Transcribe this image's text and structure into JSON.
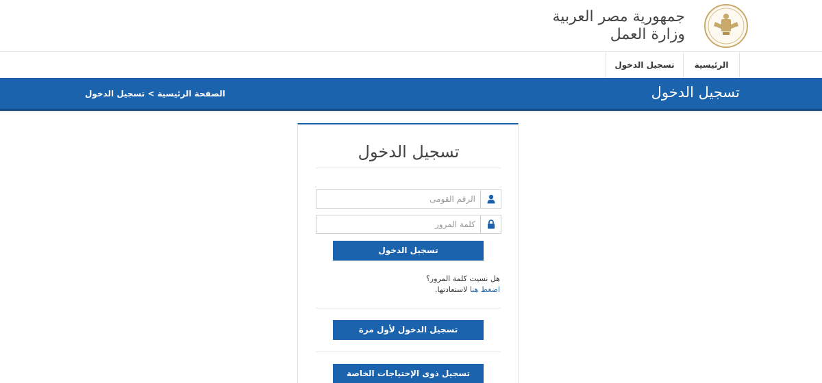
{
  "header": {
    "title_line1": "جمهورية مصر العربية",
    "title_line2": "وزارة العمل",
    "emblem_icon": "egypt-eagle-emblem-icon"
  },
  "nav": {
    "items": [
      {
        "label": "الرئيسية"
      },
      {
        "label": "تسجيل الدخول"
      }
    ]
  },
  "banner": {
    "title": "تسجيل الدخول",
    "breadcrumb": "الصفحة الرئيسية  > تسجيل الدخول"
  },
  "login_card": {
    "title": "تسجيل الدخول",
    "national_id_placeholder": "الرقم القومى",
    "password_placeholder": "كلمة المرور",
    "login_button": "تسجيل الدخول",
    "forgot_question": "هل نسيت كلمة المرور؟",
    "forgot_link": "اضغط هنا",
    "forgot_suffix": " لاستعادتها.",
    "first_time_button": "تسجيل الدخول لأول مرة",
    "special_needs_button": "تسجيل ذوى الإحتياجات الخاصة"
  },
  "colors": {
    "primary": "#1b63ad",
    "emblem_gold": "#c9a96a"
  }
}
